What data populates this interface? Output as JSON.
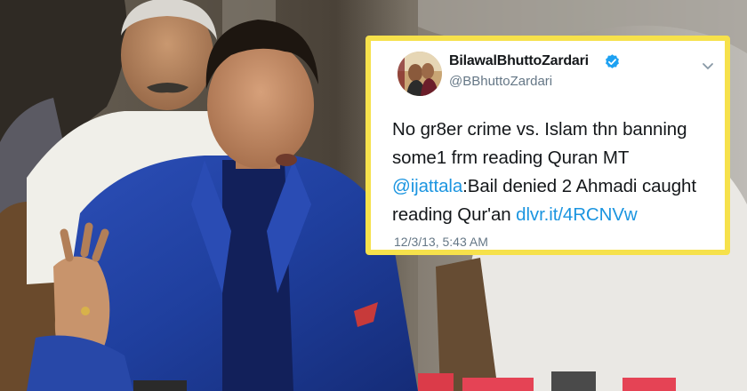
{
  "tweet": {
    "display_name": "BilawalBhuttoZardari",
    "handle": "@BBhuttoZardari",
    "text_line1": "No gr8er crime vs. Islam thn banning",
    "text_line2": "some1 frm reading Quran MT",
    "mention": "@ijattala",
    "text_line3_rest": ":Bail denied 2 Ahmadi caught",
    "text_line4": "reading Qur'an ",
    "link": "dlvr.it/4RCNVw",
    "timestamp": "12/3/13, 5:43 AM"
  },
  "colors": {
    "highlight_border": "#f6e14b",
    "link_blue": "#1b95e0",
    "verified_blue": "#1da1f2",
    "suit_blue": "#1f3f9e"
  },
  "icons": {
    "verified": "verified-badge-icon",
    "menu": "chevron-down-icon"
  }
}
